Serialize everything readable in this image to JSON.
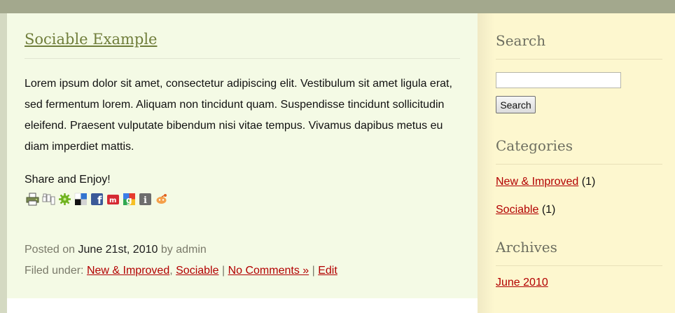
{
  "post": {
    "title": "Sociable Example",
    "body": "Lorem ipsum dolor sit amet, consectetur adipiscing elit. Vestibulum sit amet ligula erat, sed fermentum lorem. Aliquam non tincidunt quam. Suspendisse tincidunt sollicitudin eleifend. Praesent vulputate bibendum nisi vitae tempus. Vivamus dapibus metus eu diam imperdiet mattis.",
    "share_label": "Share and Enjoy!",
    "share_icons": [
      "print-icon",
      "digg-icon",
      "sphinn-icon",
      "delicious-icon",
      "facebook-icon",
      "mixx-icon",
      "google-bookmarks-icon",
      "identica-icon",
      "reddit-icon"
    ],
    "meta": {
      "posted_on_label": "Posted on",
      "date": "June 21st, 2010",
      "by_label": "by",
      "author": "admin",
      "filed_under_label": "Filed under:",
      "categories": [
        "New & Improved",
        "Sociable"
      ],
      "comma": ",",
      "separator": "|",
      "comments_link": "No Comments »",
      "edit_link": "Edit"
    }
  },
  "sidebar": {
    "search": {
      "heading": "Search",
      "input_value": "",
      "button_label": "Search"
    },
    "categories": {
      "heading": "Categories",
      "items": [
        {
          "label": "New & Improved",
          "count": "(1)"
        },
        {
          "label": "Sociable",
          "count": "(1)"
        }
      ]
    },
    "archives": {
      "heading": "Archives",
      "items": [
        {
          "label": "June 2010"
        }
      ]
    }
  },
  "colors": {
    "link": "#b20000",
    "title": "#6f7d3a",
    "top_bar": "#a3a88d",
    "content_bg": "#f4fae5",
    "sidebar_bg": "#fdf7cf"
  }
}
